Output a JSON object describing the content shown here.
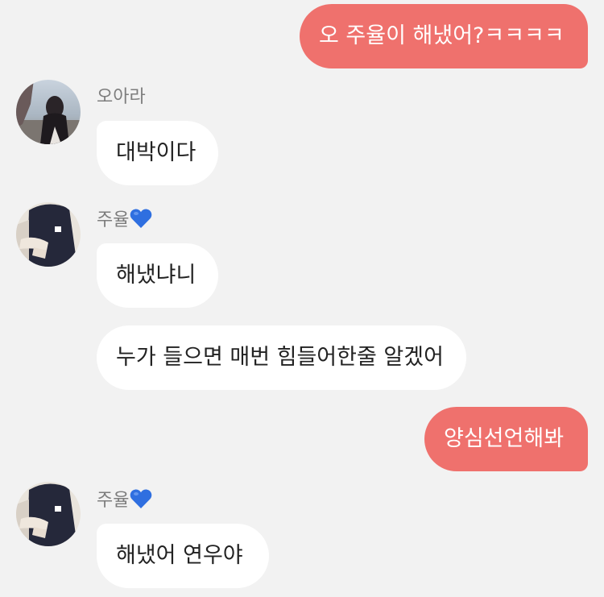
{
  "messages": [
    {
      "side": "me",
      "text": "오 주율이 해냈어?ㅋㅋㅋㅋ"
    },
    {
      "side": "them",
      "sender": "오아라",
      "text": "대박이다"
    },
    {
      "side": "them",
      "sender": "주율",
      "sender_emoji": "blue-heart",
      "text": "해냈냐니"
    },
    {
      "side": "them",
      "text": "누가 들으면 매번 힘들어한줄 알겠어"
    },
    {
      "side": "me",
      "text": "양심선언해봐"
    },
    {
      "side": "them",
      "sender": "주율",
      "sender_emoji": "blue-heart",
      "text": "해냈어 연우야"
    }
  ],
  "colors": {
    "background": "#f2f2f2",
    "my_bubble": "#ef716d",
    "their_bubble": "#ffffff",
    "heart": "#2f6fe0"
  }
}
